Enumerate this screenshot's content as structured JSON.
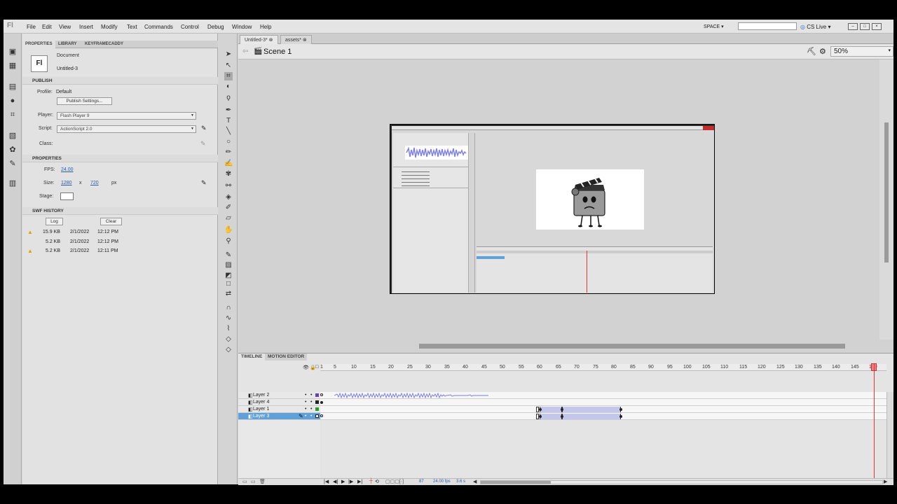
{
  "menubar": {
    "logo": "Fl",
    "items": [
      "File",
      "Edit",
      "View",
      "Insert",
      "Modify",
      "Text",
      "Commands",
      "Control",
      "Debug",
      "Window",
      "Help"
    ],
    "workspace": "SPACE",
    "cs_live": "CS Live"
  },
  "panel": {
    "tabs": [
      "PROPERTIES",
      "LIBRARY",
      "KEYFRAMECADDY"
    ],
    "doc_icon": "Fl",
    "doc_type": "Document",
    "doc_name": "Untitled-3",
    "publish": {
      "header": "PUBLISH",
      "profile_label": "Profile:",
      "profile_value": "Default",
      "settings_button": "Publish Settings...",
      "player_label": "Player:",
      "player_value": "Flash Player 9",
      "script_label": "Script:",
      "script_value": "ActionScript 2.0",
      "class_label": "Class:"
    },
    "properties": {
      "header": "PROPERTIES",
      "fps_label": "FPS:",
      "fps_value": "24.00",
      "size_label": "Size:",
      "width": "1280",
      "x": "x",
      "height": "720",
      "unit": "px",
      "stage_label": "Stage:"
    },
    "swf_history": {
      "header": "SWF HISTORY",
      "log_button": "Log",
      "clear_button": "Clear",
      "rows": [
        {
          "size": "15.9 KB",
          "date": "2/1/2022",
          "time": "12:12 PM",
          "warn": true
        },
        {
          "size": "5.2 KB",
          "date": "2/1/2022",
          "time": "12:12 PM",
          "warn": false
        },
        {
          "size": "5.2 KB",
          "date": "2/1/2022",
          "time": "12:11 PM",
          "warn": true
        }
      ]
    }
  },
  "document": {
    "tabs": [
      "Untitled-3*",
      "assets*"
    ],
    "scene": "Scene 1",
    "zoom": "50%"
  },
  "timeline": {
    "tabs": [
      "TIMELINE",
      "MOTION EDITOR"
    ],
    "ruler": [
      "1",
      "5",
      "10",
      "15",
      "20",
      "25",
      "30",
      "35",
      "40",
      "45",
      "50",
      "55",
      "60",
      "65",
      "70",
      "75",
      "80",
      "85",
      "90",
      "95",
      "100",
      "105",
      "110",
      "115",
      "120",
      "125",
      "130",
      "135",
      "140",
      "145",
      "150"
    ],
    "layers": [
      "Layer 2",
      "Layer 4",
      "Layer 1",
      "Layer 3"
    ],
    "selected_layer": "Layer 3",
    "current_frame": "87",
    "fps": "24.00 fps",
    "time": "3.6 s"
  },
  "colors": {
    "accent": "#5fa0d8",
    "playhead": "#e33333",
    "tween": "#c4c6ec"
  }
}
